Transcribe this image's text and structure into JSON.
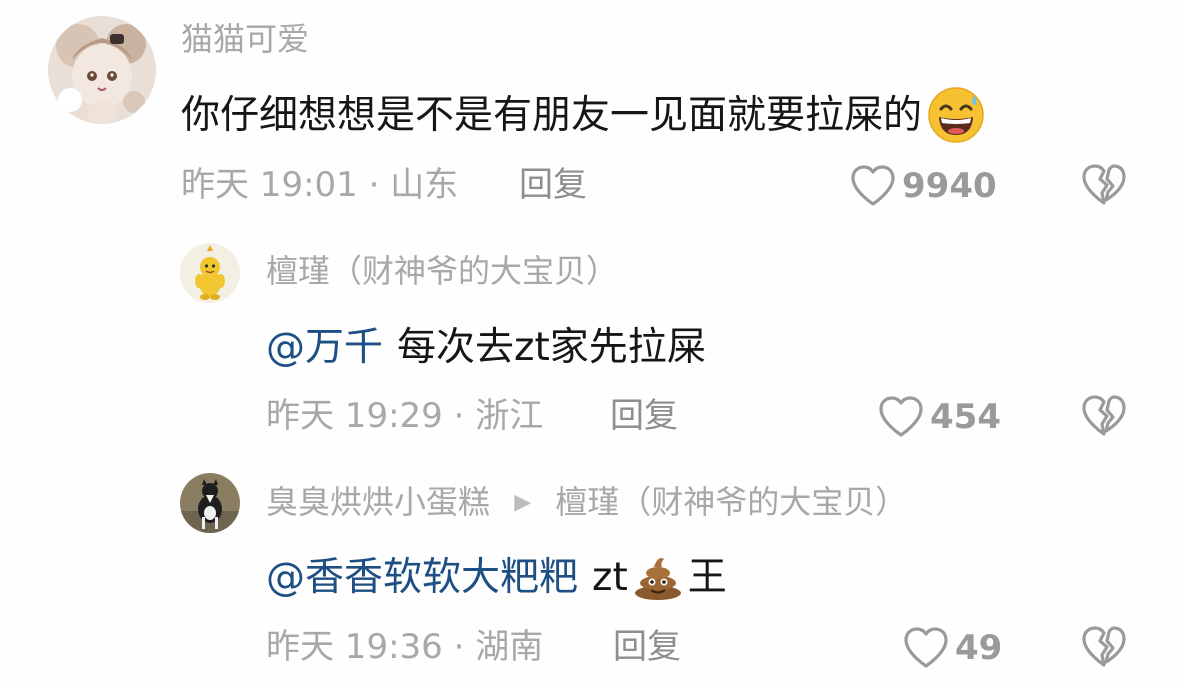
{
  "comments": [
    {
      "author": "猫猫可爱",
      "text": "你仔细想想是不是有朋友一见面就要拉屎的",
      "emoji": "grinning-sweat-face",
      "time_location": "昨天 19:01 · 山东",
      "reply_label": "回复",
      "likes": "9940"
    },
    {
      "author": "檀瑾（财神爷的大宝贝）",
      "mention": "@万千",
      "text": "每次去zt家先拉屎",
      "time_location": "昨天 19:29 · 浙江",
      "reply_label": "回复",
      "likes": "454"
    },
    {
      "author": "臭臭烘烘小蛋糕",
      "reply_to": "檀瑾（财神爷的大宝贝）",
      "mention": "@香香软软大粑粑",
      "text_before_emoji": "zt",
      "emoji": "pile-of-poo",
      "text_after_emoji": "王",
      "time_location": "昨天 19:36 · 湖南",
      "reply_label": "回复",
      "likes": "49"
    }
  ],
  "colors": {
    "author": "#a8a8a8",
    "text": "#161616",
    "mention": "#1e4f84",
    "meta": "#a8a8a8"
  }
}
